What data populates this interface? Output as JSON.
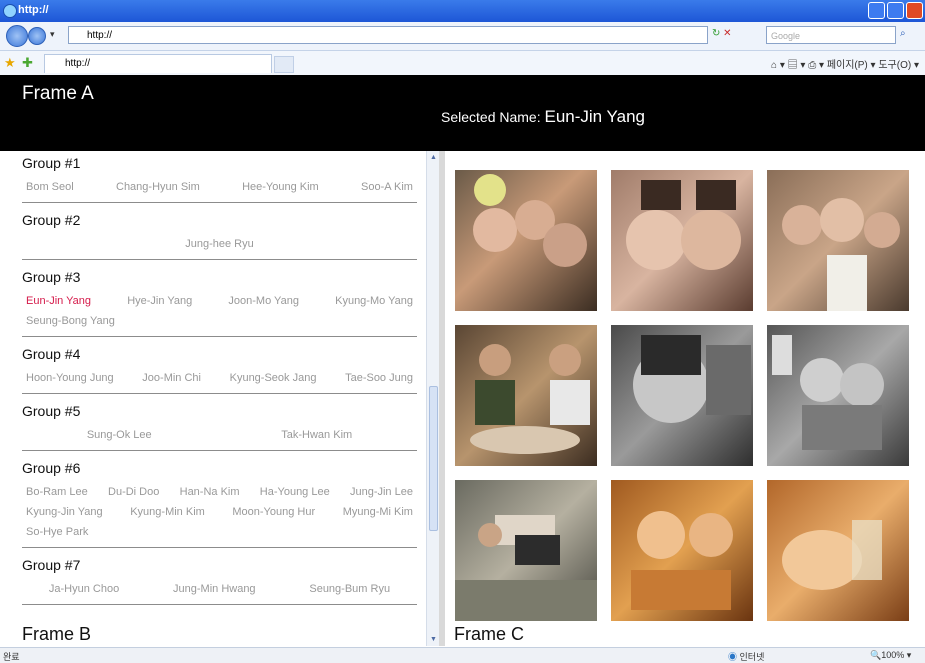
{
  "window": {
    "title": "http://"
  },
  "address_bar": {
    "url": "http://",
    "search_placeholder": "Google"
  },
  "favorites_bar": {
    "tab_title": "http://",
    "toolbar_page": "페이지(P)",
    "toolbar_tools": "도구(O)"
  },
  "frame_a": {
    "label": "Frame A",
    "selected_prefix": "Selected Name: ",
    "selected_name": "Eun-Jin Yang"
  },
  "frame_b": {
    "label": "Frame B",
    "groups": [
      {
        "name": "Group #1",
        "members": [
          "Bom Seol",
          "Chang-Hyun Sim",
          "Hee-Young Kim",
          "Soo-A Kim"
        ]
      },
      {
        "name": "Group #2",
        "members": [
          "Jung-hee Ryu"
        ]
      },
      {
        "name": "Group #3",
        "members": [
          "Eun-Jin Yang",
          "Hye-Jin Yang",
          "Joon-Mo Yang",
          "Kyung-Mo Yang",
          "Seung-Bong Yang"
        ]
      },
      {
        "name": "Group #4",
        "members": [
          "Hoon-Young Jung",
          "Joo-Min Chi",
          "Kyung-Seok Jang",
          "Tae-Soo Jung"
        ]
      },
      {
        "name": "Group #5",
        "members": [
          "Sung-Ok Lee",
          "Tak-Hwan Kim"
        ]
      },
      {
        "name": "Group #6",
        "members": [
          "Bo-Ram Lee",
          "Du-Di Doo",
          "Han-Na Kim",
          "Ha-Young Lee",
          "Jung-Jin Lee",
          "Kyung-Jin Yang",
          "Kyung-Min Kim",
          "Moon-Young Hur",
          "Myung-Mi Kim",
          "So-Hye Park"
        ]
      },
      {
        "name": "Group #7",
        "members": [
          "Ja-Hyun Choo",
          "Jung-Min Hwang",
          "Seung-Bum Ryu"
        ]
      }
    ]
  },
  "frame_c": {
    "label": "Frame C"
  },
  "status_bar": {
    "done": "완료",
    "zone": "인터넷",
    "zoom": "100%"
  },
  "colors": {
    "selected_member": "#d51a4a",
    "member": "#999999",
    "frame_a_bg": "#000000"
  }
}
